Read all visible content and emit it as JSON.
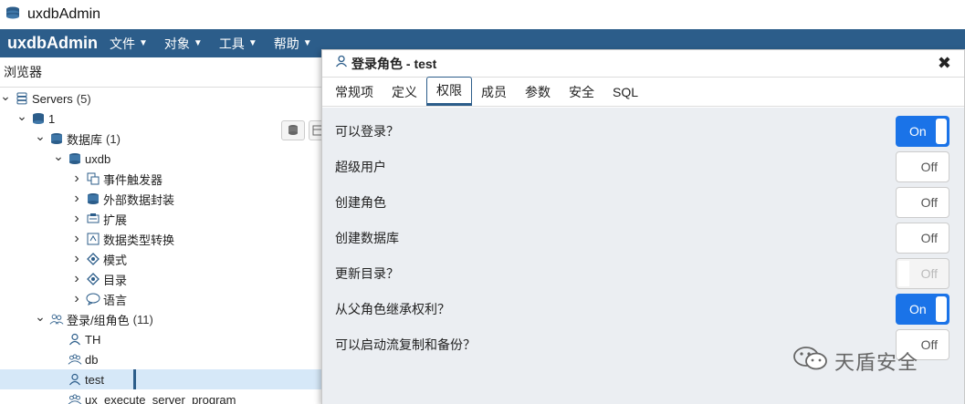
{
  "window": {
    "title": "uxdbAdmin",
    "icon": "database-stack-icon"
  },
  "menubar": {
    "brand": "uxdbAdmin",
    "items": [
      {
        "label": "文件"
      },
      {
        "label": "对象"
      },
      {
        "label": "工具"
      },
      {
        "label": "帮助"
      }
    ]
  },
  "browser": {
    "title": "浏览器",
    "tree": [
      {
        "label": "Servers",
        "count": "(5)",
        "icon": "servers-icon",
        "expanded": true
      },
      {
        "label": "1",
        "count": "",
        "icon": "server-icon",
        "expanded": true
      },
      {
        "label": "数据库",
        "count": "(1)",
        "icon": "databases-icon",
        "expanded": true
      },
      {
        "label": "uxdb",
        "count": "",
        "icon": "database-icon",
        "expanded": true
      },
      {
        "label": "事件触发器",
        "count": "",
        "icon": "event-trigger-icon",
        "expanded": false
      },
      {
        "label": "外部数据封装",
        "count": "",
        "icon": "foreign-data-wrapper-icon",
        "expanded": false
      },
      {
        "label": "扩展",
        "count": "",
        "icon": "extension-icon",
        "expanded": false
      },
      {
        "label": "数据类型转换",
        "count": "",
        "icon": "cast-icon",
        "expanded": false
      },
      {
        "label": "模式",
        "count": "",
        "icon": "schema-icon",
        "expanded": false
      },
      {
        "label": "目录",
        "count": "",
        "icon": "catalog-icon",
        "expanded": false
      },
      {
        "label": "语言",
        "count": "",
        "icon": "language-icon",
        "expanded": false
      },
      {
        "label": "登录/组角色",
        "count": "(11)",
        "icon": "roles-icon",
        "expanded": true
      },
      {
        "label": "TH",
        "count": "",
        "icon": "login-role-icon",
        "expanded": null
      },
      {
        "label": "db",
        "count": "",
        "icon": "group-role-icon",
        "expanded": null
      },
      {
        "label": "test",
        "count": "",
        "icon": "login-role-icon",
        "expanded": null,
        "selected": true
      },
      {
        "label": "ux_execute_server_program",
        "count": "",
        "icon": "group-role-icon",
        "expanded": null
      }
    ]
  },
  "dialog": {
    "title": "登录角色 - test",
    "tabs": [
      "常规项",
      "定义",
      "权限",
      "成员",
      "参数",
      "安全",
      "SQL"
    ],
    "active_tab": "权限",
    "permissions": [
      {
        "label": "可以登录？",
        "value": "On",
        "state": "on"
      },
      {
        "label": "超级用户",
        "value": "Off",
        "state": "off"
      },
      {
        "label": "创建角色",
        "value": "Off",
        "state": "off"
      },
      {
        "label": "创建数据库",
        "value": "Off",
        "state": "off"
      },
      {
        "label": "更新目录？",
        "value": "Off",
        "state": "disabled"
      },
      {
        "label": "从父角色继承权利？",
        "value": "On",
        "state": "on"
      },
      {
        "label": "可以启动流复制和备份？",
        "value": "Off",
        "state": "off"
      }
    ]
  },
  "watermark": {
    "text": "天盾安全"
  },
  "colors": {
    "menubar": "#2c5d8a",
    "toggle_on": "#1a73e8",
    "dialog_body": "#ebeef2"
  }
}
